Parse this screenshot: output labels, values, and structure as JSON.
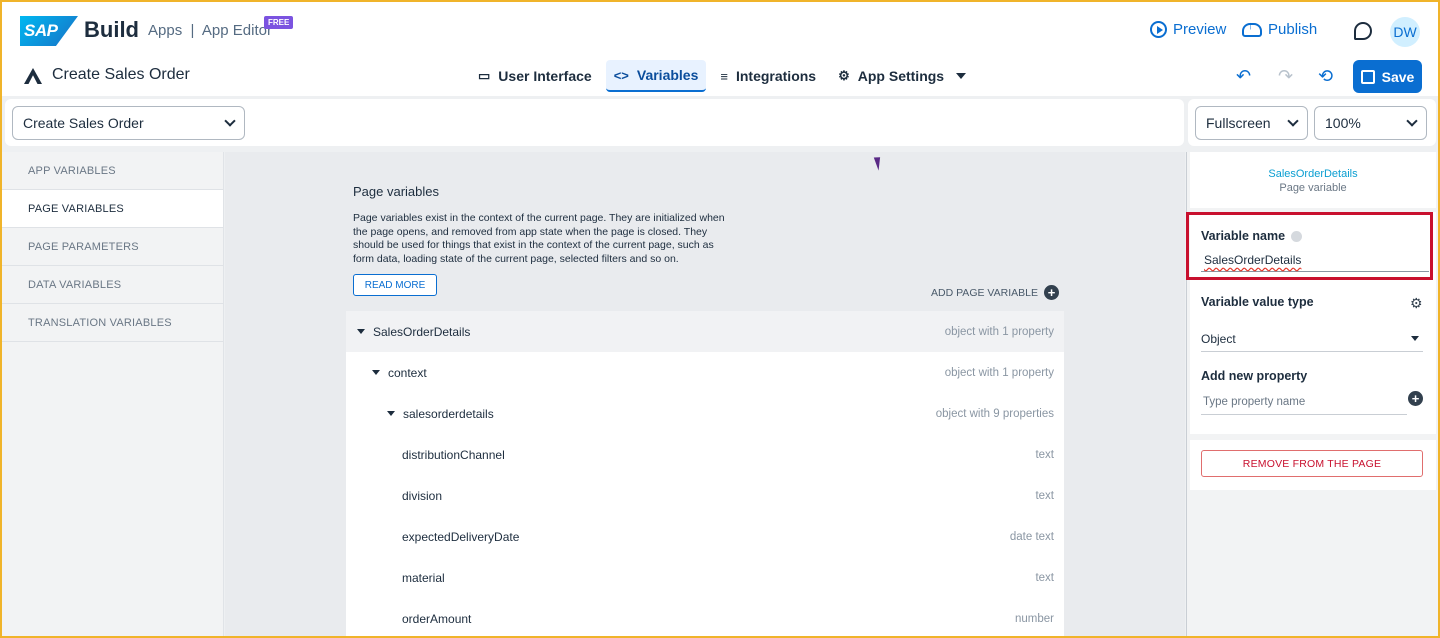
{
  "shell": {
    "logo_text": "SAP",
    "brand": "Build",
    "product": "Apps  |  App Editor",
    "badge": "FREE",
    "preview_label": "Preview",
    "publish_label": "Publish",
    "avatar_initials": "DW"
  },
  "app": {
    "title": "Create Sales Order"
  },
  "tabs": [
    {
      "label": "User Interface",
      "icon": "monitor-icon"
    },
    {
      "label": "Variables",
      "icon": "code-icon",
      "active": true
    },
    {
      "label": "Integrations",
      "icon": "database-icon"
    },
    {
      "label": "App Settings",
      "icon": "gear-icon"
    }
  ],
  "tab_icons": {
    "code": "<>",
    "gear": "⚙",
    "db": "≡",
    "monitor": "▭"
  },
  "toolbar": {
    "save_label": "Save",
    "undo_icon": "↶",
    "redo_icon": "↷",
    "history_icon": "⟲",
    "page_select": "Create Sales Order",
    "view_select": "Fullscreen",
    "zoom_select": "100%"
  },
  "nav": {
    "items": [
      {
        "label": "APP VARIABLES"
      },
      {
        "label": "PAGE VARIABLES",
        "active": true
      },
      {
        "label": "PAGE PARAMETERS"
      },
      {
        "label": "DATA VARIABLES"
      },
      {
        "label": "TRANSLATION VARIABLES"
      }
    ]
  },
  "main": {
    "title": "Page variables",
    "description": "Page variables exist in the context of the current page. They are initialized when the page opens, and removed from app state when the page is closed. They should be used for things that exist in the context of the current page, such as form data, loading state of the current page, selected filters and so on.",
    "read_more": "READ MORE",
    "add_variable": "ADD PAGE VARIABLE",
    "rows": [
      {
        "name": "SalesOrderDetails",
        "type": "object with 1 property"
      },
      {
        "name": "context",
        "type": "object with 1 property"
      },
      {
        "name": "salesorderdetails",
        "type": "object with 9 properties"
      },
      {
        "name": "distributionChannel",
        "type": "text"
      },
      {
        "name": "division",
        "type": "text"
      },
      {
        "name": "expectedDeliveryDate",
        "type": "date text"
      },
      {
        "name": "material",
        "type": "text"
      },
      {
        "name": "orderAmount",
        "type": "number"
      }
    ]
  },
  "panel": {
    "var_name": "SalesOrderDetails",
    "var_kind": "Page variable",
    "variable_name_label": "Variable name",
    "variable_name_value": "SalesOrderDetails",
    "value_type_label": "Variable value type",
    "value_type_value": "Object",
    "add_property_label": "Add new property",
    "add_property_placeholder": "Type property name",
    "remove_label": "REMOVE FROM THE PAGE"
  },
  "colors": {
    "accent": "#0a6ed1",
    "highlight_box": "#c8102e",
    "badge": "#7b53e0"
  }
}
